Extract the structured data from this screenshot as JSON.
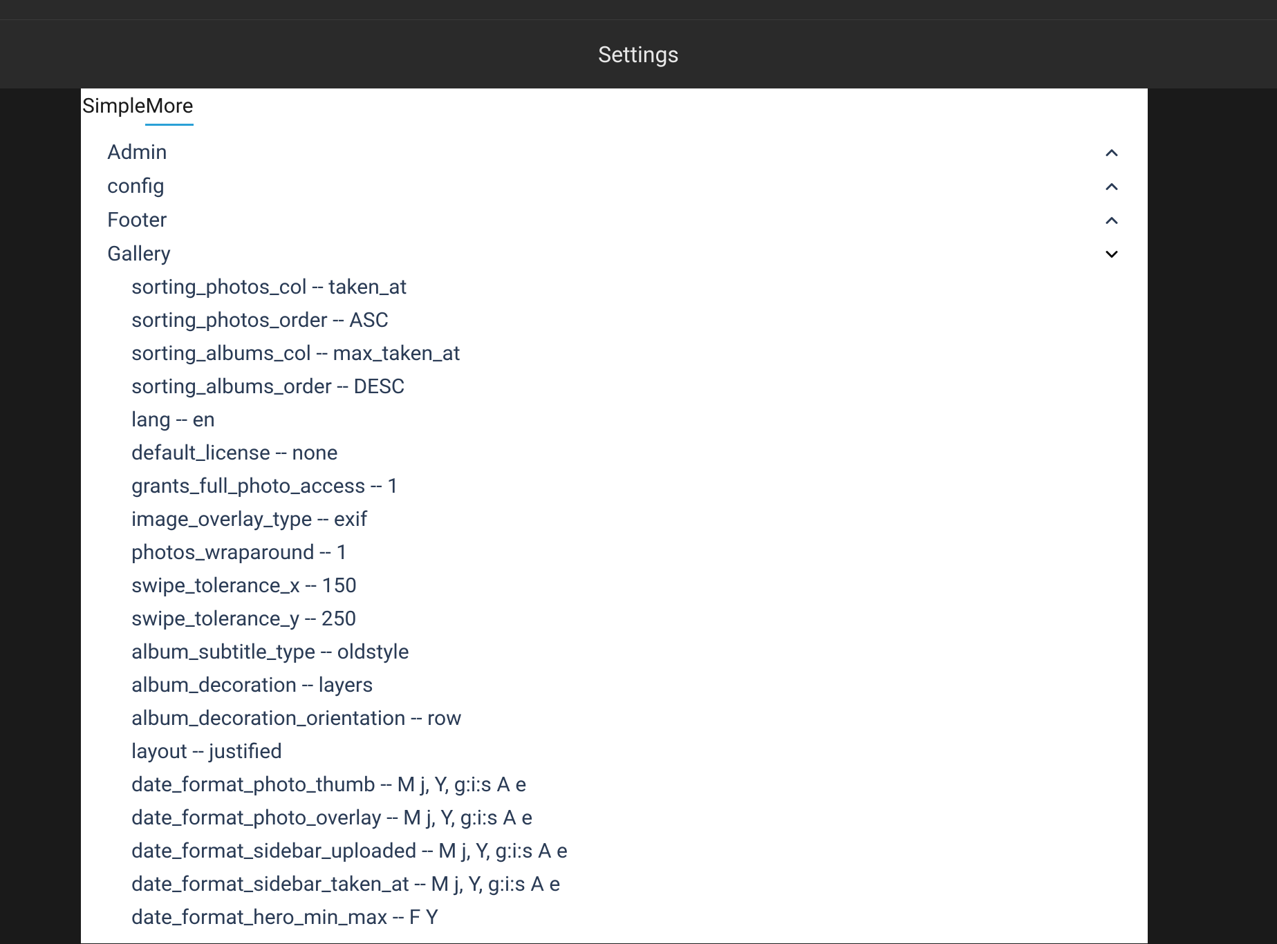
{
  "header": {
    "title": "Settings"
  },
  "tabs": [
    {
      "label": "Simple",
      "active": false
    },
    {
      "label": "More",
      "active": true
    }
  ],
  "sections": [
    {
      "name": "Admin",
      "expanded": false,
      "items": []
    },
    {
      "name": "config",
      "expanded": false,
      "items": []
    },
    {
      "name": "Footer",
      "expanded": false,
      "items": []
    },
    {
      "name": "Gallery",
      "expanded": true,
      "items": [
        {
          "key": "sorting_photos_col",
          "value": "taken_at"
        },
        {
          "key": "sorting_photos_order",
          "value": "ASC"
        },
        {
          "key": "sorting_albums_col",
          "value": "max_taken_at"
        },
        {
          "key": "sorting_albums_order",
          "value": "DESC"
        },
        {
          "key": "lang",
          "value": "en"
        },
        {
          "key": "default_license",
          "value": "none"
        },
        {
          "key": "grants_full_photo_access",
          "value": "1"
        },
        {
          "key": "image_overlay_type",
          "value": "exif"
        },
        {
          "key": "photos_wraparound",
          "value": "1"
        },
        {
          "key": "swipe_tolerance_x",
          "value": "150"
        },
        {
          "key": "swipe_tolerance_y",
          "value": "250"
        },
        {
          "key": "album_subtitle_type",
          "value": "oldstyle"
        },
        {
          "key": "album_decoration",
          "value": "layers"
        },
        {
          "key": "album_decoration_orientation",
          "value": "row"
        },
        {
          "key": "layout",
          "value": "justified"
        },
        {
          "key": "date_format_photo_thumb",
          "value": "M j, Y, g:i:s A e"
        },
        {
          "key": "date_format_photo_overlay",
          "value": "M j, Y, g:i:s A e"
        },
        {
          "key": "date_format_sidebar_uploaded",
          "value": "M j, Y, g:i:s A e"
        },
        {
          "key": "date_format_sidebar_taken_at",
          "value": "M j, Y, g:i:s A e"
        },
        {
          "key": "date_format_hero_min_max",
          "value": "F Y"
        }
      ]
    }
  ],
  "separator": " -- "
}
